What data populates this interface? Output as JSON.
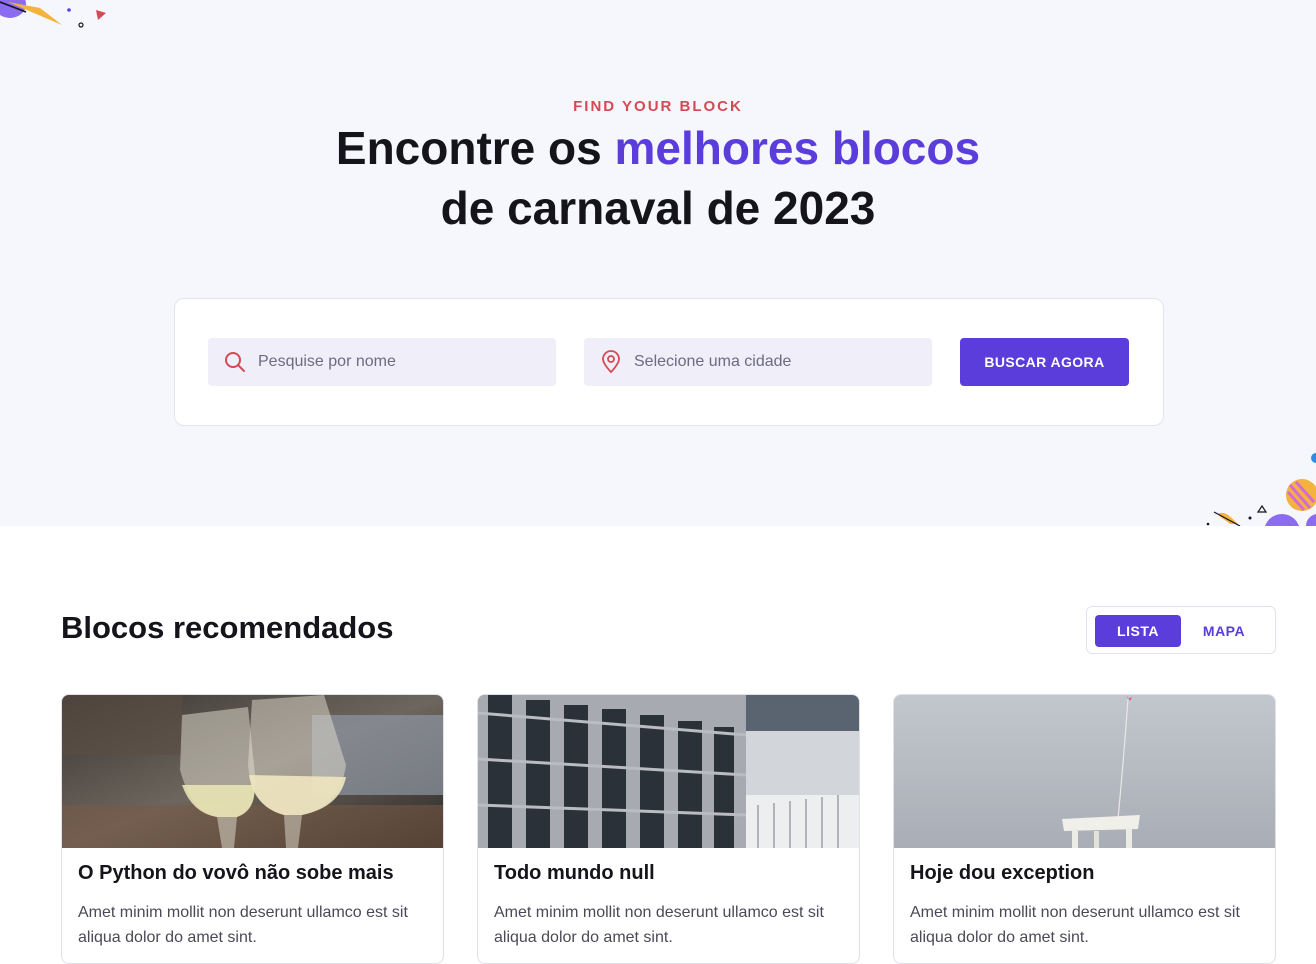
{
  "hero": {
    "eyebrow": "FIND YOUR BLOCK",
    "headline_part1": "Encontre os ",
    "headline_accent": "melhores blocos",
    "headline_part2": "de carnaval de 2023"
  },
  "search": {
    "name_placeholder": "Pesquise por nome",
    "city_placeholder": "Selecione uma cidade",
    "button_label": "BUSCAR AGORA",
    "name_icon": "search-icon",
    "city_icon": "map-pin-icon"
  },
  "section": {
    "title": "Blocos recomendados",
    "view_options": [
      "LISTA",
      "MAPA"
    ],
    "active_view": "LISTA"
  },
  "cards": [
    {
      "title": "O Python do vovô não sobe mais",
      "description": "Amet minim mollit non deserunt ullamco est sit aliqua dolor do amet sint.",
      "image": "wine-glasses-toast-photo"
    },
    {
      "title": "Todo mundo null",
      "description": "Amet minim mollit non deserunt ullamco est sit aliqua dolor do amet sint.",
      "image": "office-building-photo"
    },
    {
      "title": "Hoje dou exception",
      "description": "Amet minim mollit non deserunt ullamco est sit aliqua dolor do amet sint.",
      "image": "hanging-chair-balloon-photo"
    }
  ],
  "colors": {
    "accent": "#5a3ddb",
    "eyebrow": "#d44a54",
    "hero_bg": "#f6f6fd",
    "field_bg": "#efeef9"
  }
}
